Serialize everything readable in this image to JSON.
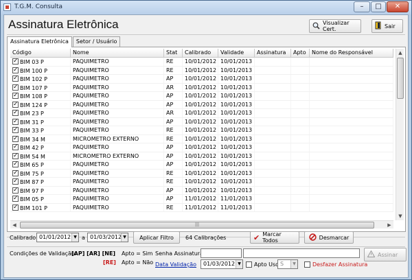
{
  "window": {
    "title": "T.G.M. Consulta",
    "minimize": "–",
    "maximize": "□",
    "close": "✕"
  },
  "header": {
    "title": "Assinatura Eletrônica",
    "visualizar_label": "Visualizar Cert.",
    "sair_label": "Sair"
  },
  "tabs": [
    {
      "label": "Assinatura Eletrônica"
    },
    {
      "label": "Setor / Usuário"
    }
  ],
  "grid": {
    "columns": [
      "Código",
      "Nome",
      "Stat",
      "Calibrado",
      "Validade",
      "Assinatura",
      "Apto",
      "Nome do Responsável"
    ],
    "rows": [
      {
        "code": "BIM 03 P",
        "name": "PAQUIMETRO",
        "stat": "RE",
        "cal": "10/01/2012",
        "val": "10/01/2013"
      },
      {
        "code": "BIM 100 P",
        "name": "PAQUIMETRO",
        "stat": "RE",
        "cal": "10/01/2012",
        "val": "10/01/2013"
      },
      {
        "code": "BIM 102 P",
        "name": "PAQUIMETRO",
        "stat": "AP",
        "cal": "10/01/2012",
        "val": "10/01/2013"
      },
      {
        "code": "BIM 107 P",
        "name": "PAQUIMETRO",
        "stat": "AR",
        "cal": "10/01/2012",
        "val": "10/01/2013"
      },
      {
        "code": "BIM 108 P",
        "name": "PAQUIMETRO",
        "stat": "AP",
        "cal": "10/01/2012",
        "val": "10/01/2013"
      },
      {
        "code": "BIM 124 P",
        "name": "PAQUIMETRO",
        "stat": "AP",
        "cal": "10/01/2012",
        "val": "10/01/2013"
      },
      {
        "code": "BIM 23 P",
        "name": "PAQUIMETRO",
        "stat": "AR",
        "cal": "10/01/2012",
        "val": "10/01/2013"
      },
      {
        "code": "BIM 31 P",
        "name": "PAQUIMETRO",
        "stat": "AP",
        "cal": "10/01/2012",
        "val": "10/01/2013"
      },
      {
        "code": "BIM 33 P",
        "name": "PAQUIMETRO",
        "stat": "RE",
        "cal": "10/01/2012",
        "val": "10/01/2013"
      },
      {
        "code": "BIM 34 M",
        "name": "MICROMETRO EXTERNO",
        "stat": "RE",
        "cal": "10/01/2012",
        "val": "10/01/2013"
      },
      {
        "code": "BIM 42 P",
        "name": "PAQUIMETRO",
        "stat": "AP",
        "cal": "10/01/2012",
        "val": "10/01/2013"
      },
      {
        "code": "BIM 54 M",
        "name": "MICROMETRO EXTERNO",
        "stat": "AP",
        "cal": "10/01/2012",
        "val": "10/01/2013"
      },
      {
        "code": "BIM 65 P",
        "name": "PAQUIMETRO",
        "stat": "AP",
        "cal": "10/01/2012",
        "val": "10/01/2013"
      },
      {
        "code": "BIM 75 P",
        "name": "PAQUIMETRO",
        "stat": "RE",
        "cal": "10/01/2012",
        "val": "10/01/2013"
      },
      {
        "code": "BIM 87 P",
        "name": "PAQUIMETRO",
        "stat": "RE",
        "cal": "10/01/2012",
        "val": "10/01/2013"
      },
      {
        "code": "BIM 97 P",
        "name": "PAQUIMETRO",
        "stat": "AP",
        "cal": "10/01/2012",
        "val": "10/01/2013"
      },
      {
        "code": "BIM 05 P",
        "name": "PAQUIMETRO",
        "stat": "AP",
        "cal": "11/01/2012",
        "val": "11/01/2013"
      },
      {
        "code": "BIM 101 P",
        "name": "PAQUIMETRO",
        "stat": "RE",
        "cal": "11/01/2012",
        "val": "11/01/2013"
      }
    ]
  },
  "filter": {
    "calibrado_label": "Calibrado",
    "date_from": "01/01/2012",
    "a_label": "a",
    "date_to": "01/03/2012",
    "apply_label": "Aplicar Filtro",
    "count_text": "64 Calibrações",
    "mark_all_label": "Marcar Todos",
    "unmark_label": "Desmarcar"
  },
  "validation": {
    "conditions_label": "Condições de Validação:",
    "codes_ok": "[AP] [AR] [NE]",
    "apto_sim": "Apto = Sim",
    "code_re": "[RE]",
    "apto_nao": "Apto = Não",
    "senha_label": "Senha Assinatura",
    "data_link": "Data Validação",
    "date": "01/03/2012",
    "apto_uso_label": "Apto Uso",
    "apto_uso_value": "S",
    "desfazer_label": "Desfazer Assinatura",
    "assinar_label": "Assinar"
  }
}
